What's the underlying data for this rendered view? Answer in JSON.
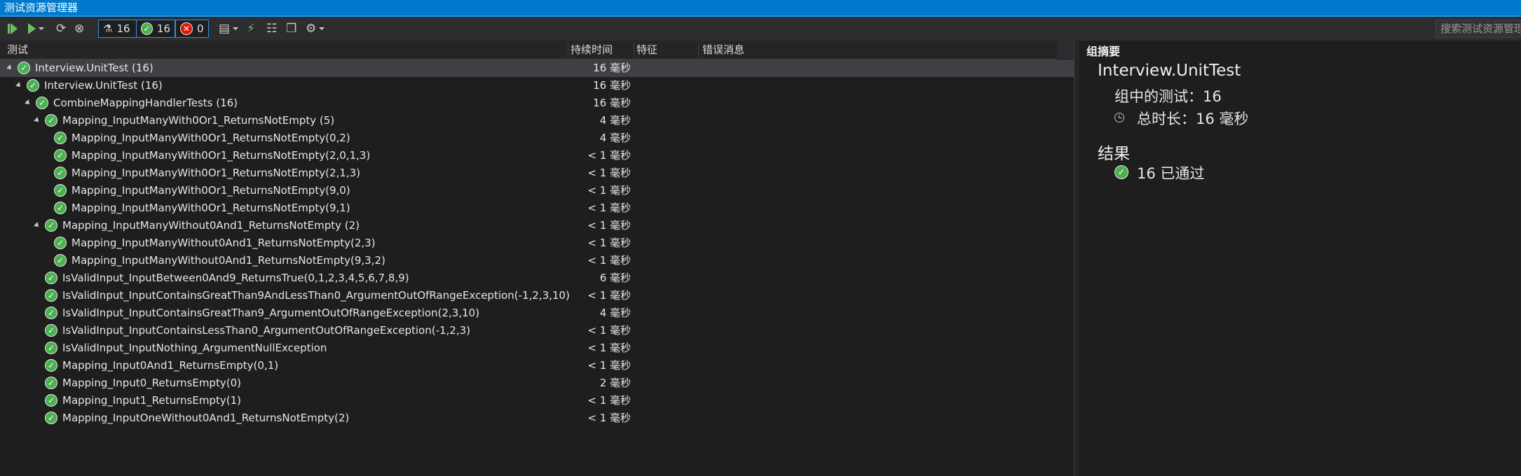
{
  "window": {
    "title": "测试资源管理器"
  },
  "toolbar": {
    "counters": {
      "total": "16",
      "passed": "16",
      "failed": "0"
    },
    "search_placeholder": "搜索测试资源管理"
  },
  "columns": {
    "test": "测试",
    "duration": "持续时间",
    "traits": "特征",
    "error": "错误消息"
  },
  "tree": [
    {
      "name": "Interview.UnitTest (16)",
      "duration": "16 毫秒",
      "level": 0,
      "expandable": true
    },
    {
      "name": "Interview.UnitTest (16)",
      "duration": "16 毫秒",
      "level": 1,
      "expandable": true
    },
    {
      "name": "CombineMappingHandlerTests (16)",
      "duration": "16 毫秒",
      "level": 2,
      "expandable": true
    },
    {
      "name": "Mapping_InputManyWith0Or1_ReturnsNotEmpty (5)",
      "duration": "4 毫秒",
      "level": 3,
      "expandable": true
    },
    {
      "name": "Mapping_InputManyWith0Or1_ReturnsNotEmpty(0,2)",
      "duration": "4 毫秒",
      "level": 4,
      "expandable": false
    },
    {
      "name": "Mapping_InputManyWith0Or1_ReturnsNotEmpty(2,0,1,3)",
      "duration": "< 1 毫秒",
      "level": 4,
      "expandable": false
    },
    {
      "name": "Mapping_InputManyWith0Or1_ReturnsNotEmpty(2,1,3)",
      "duration": "< 1 毫秒",
      "level": 4,
      "expandable": false
    },
    {
      "name": "Mapping_InputManyWith0Or1_ReturnsNotEmpty(9,0)",
      "duration": "< 1 毫秒",
      "level": 4,
      "expandable": false
    },
    {
      "name": "Mapping_InputManyWith0Or1_ReturnsNotEmpty(9,1)",
      "duration": "< 1 毫秒",
      "level": 4,
      "expandable": false
    },
    {
      "name": "Mapping_InputManyWithout0And1_ReturnsNotEmpty (2)",
      "duration": "< 1 毫秒",
      "level": 3,
      "expandable": true
    },
    {
      "name": "Mapping_InputManyWithout0And1_ReturnsNotEmpty(2,3)",
      "duration": "< 1 毫秒",
      "level": 4,
      "expandable": false
    },
    {
      "name": "Mapping_InputManyWithout0And1_ReturnsNotEmpty(9,3,2)",
      "duration": "< 1 毫秒",
      "level": 4,
      "expandable": false
    },
    {
      "name": "IsValidInput_InputBetween0And9_ReturnsTrue(0,1,2,3,4,5,6,7,8,9)",
      "duration": "6 毫秒",
      "level": 3,
      "expandable": false
    },
    {
      "name": "IsValidInput_InputContainsGreatThan9AndLessThan0_ArgumentOutOfRangeException(-1,2,3,10)",
      "duration": "< 1 毫秒",
      "level": 3,
      "expandable": false
    },
    {
      "name": "IsValidInput_InputContainsGreatThan9_ArgumentOutOfRangeException(2,3,10)",
      "duration": "4 毫秒",
      "level": 3,
      "expandable": false
    },
    {
      "name": "IsValidInput_InputContainsLessThan0_ArgumentOutOfRangeException(-1,2,3)",
      "duration": "< 1 毫秒",
      "level": 3,
      "expandable": false
    },
    {
      "name": "IsValidInput_InputNothing_ArgumentNullException",
      "duration": "< 1 毫秒",
      "level": 3,
      "expandable": false
    },
    {
      "name": "Mapping_Input0And1_ReturnsEmpty(0,1)",
      "duration": "< 1 毫秒",
      "level": 3,
      "expandable": false
    },
    {
      "name": "Mapping_Input0_ReturnsEmpty(0)",
      "duration": "2 毫秒",
      "level": 3,
      "expandable": false
    },
    {
      "name": "Mapping_Input1_ReturnsEmpty(1)",
      "duration": "< 1 毫秒",
      "level": 3,
      "expandable": false
    },
    {
      "name": "Mapping_InputOneWithout0And1_ReturnsNotEmpty(2)",
      "duration": "< 1 毫秒",
      "level": 3,
      "expandable": false
    }
  ],
  "summary": {
    "title": "组摘要",
    "group_name": "Interview.UnitTest",
    "tests_in_group": "组中的测试：16",
    "total_duration": "总时长：16 毫秒",
    "results_title": "结果",
    "passed_text": "16 已通过"
  }
}
